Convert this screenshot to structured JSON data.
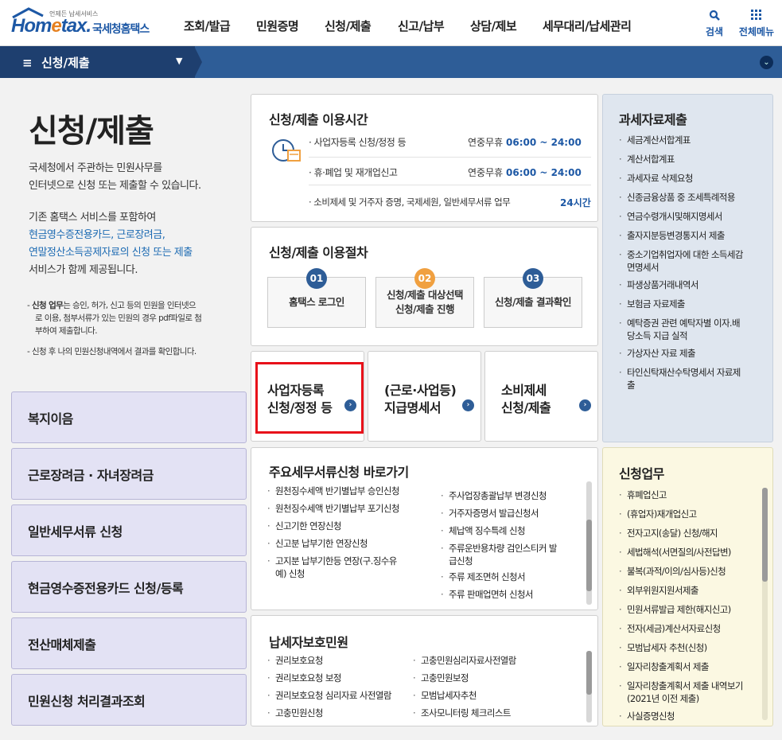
{
  "header": {
    "logo_tagline": "언제든 납세서비스",
    "logo_brand_a": "Hom",
    "logo_brand_e": "e",
    "logo_brand_b": "tax.",
    "logo_korean": "국세청홈택스",
    "menu": [
      "조회/발급",
      "민원증명",
      "신청/제출",
      "신고/납부",
      "상담/제보",
      "세무대리/납세관리"
    ],
    "search_label": "검색",
    "allmenu_label": "전체메뉴"
  },
  "subnav": {
    "title": "신청/제출",
    "hamburger": "≡",
    "caret": "▼",
    "expand": "⌄"
  },
  "intro": {
    "page_title": "신청/제출",
    "desc1_l1": "국세청에서 주관하는 민원사무를",
    "desc1_l2": "인터넷으로 신청 또는 제출할 수 있습니다.",
    "desc2_l1": "기존 홈택스 서비스를 포함하여",
    "desc2_blue1": "현금영수증전용카드, 근로장려금,",
    "desc2_blue2": "연말정산소득공제자료의 신청 또는 제출",
    "desc2_l4": "서비스가 함께 제공됩니다.",
    "note1_bold": "신청 업무",
    "note1_rest": "는 승인, 허가, 신고 등의 민원을 인터넷으",
    "note1_l2": "로 이용, 첨부서류가 있는 민원의 경우 pdf파일로 첨",
    "note1_l3": "부하여 제출합니다.",
    "note2": "신청 후 나의 민원신청내역에서 결과를 확인합니다."
  },
  "left_buttons": [
    "복지이음",
    "근로장려금 · 자녀장려금",
    "일반세무서류 신청",
    "현금영수증전용카드 신청/등록",
    "전산매체제출",
    "민원신청 처리결과조회"
  ],
  "hours": {
    "title": "신청/제출 이용시간",
    "rows": [
      {
        "label": "· 사업자등록 신청/정정 등",
        "prefix": "연중무휴",
        "time": "06:00 ~ 24:00"
      },
      {
        "label": "· 휴·폐업 및 재개업신고",
        "prefix": "연중무휴",
        "time": "06:00 ~ 24:00"
      },
      {
        "label": "· 소비제세 및 거주자 증명, 국제세원, 일반세무서류 업무",
        "prefix": "",
        "time": "24시간"
      }
    ]
  },
  "process": {
    "title": "신청/제출 이용절차",
    "steps": [
      {
        "num": "01",
        "l1": "홈택스 로그인",
        "l2": "",
        "color": "#2e5d97"
      },
      {
        "num": "02",
        "l1": "신청/제출 대상선택",
        "l2": "신청/제출 진행",
        "color": "#f0a040"
      },
      {
        "num": "03",
        "l1": "신청/제출 결과확인",
        "l2": "",
        "color": "#2e5d97"
      }
    ]
  },
  "big_cards": [
    {
      "l1": "사업자등록",
      "l2": "신청/정정 등",
      "highlighted": true
    },
    {
      "l1": "(근로·사업등)",
      "l2": "지급명세서",
      "highlighted": false
    },
    {
      "l1": "소비제세",
      "l2": "신청/제출",
      "highlighted": false
    }
  ],
  "tax_data": {
    "title": "과세자료제출",
    "items": [
      "세금계산서합계표",
      "계산서합계표",
      "과세자료 삭제요청",
      "신종금융상품 중 조세특례적용",
      "연금수령개시및해지명세서",
      "출자지분등변경통지서 제출",
      "중소기업취업자에 대한 소득세감",
      "면명세서",
      "파생상품거래내역서",
      "보험금 자료제출",
      "예탁증권 관련 예탁자별 이자.배",
      "당소득 지급 실적",
      "가상자산 자료 제출",
      "타인신탁재산수탁명세서 자료제",
      "출"
    ]
  },
  "shortcuts": {
    "title": "주요세무서류신청 바로가기",
    "col1": [
      "원천징수세액 반기별납부 승인신청",
      "원천징수세액 반기별납부 포기신청",
      "신고기한 연장신청",
      "신고분 납부기한 연장신청",
      "고지분 납부기한등 연장(구.징수유",
      "예) 신청"
    ],
    "col2": [
      "주사업장총괄납부 변경신청",
      "거주자증명서 발급신청서",
      "체납액 징수특례 신청",
      "주류운반용차량 검인스티커 발",
      "급신청",
      "주류 제조면허 신청서",
      "주류 판매업면허 신청서"
    ]
  },
  "protection": {
    "title": "납세자보호민원",
    "col1": [
      "권리보호요청",
      "권리보호요청 보정",
      "권리보호요청 심리자료 사전열람",
      "고충민원신청"
    ],
    "col2": [
      "고충민원심리자료사전열람",
      "고충민원보정",
      "모범납세자추천",
      "조사모니터링 체크리스트"
    ]
  },
  "apply_work": {
    "title": "신청업무",
    "items": [
      "휴폐업신고",
      "(휴업자)재개업신고",
      "전자고지(송달) 신청/해지",
      "세법해석(서면질의/사전답변)",
      "불복(과적/이의/심사등)신청",
      "외부위원지원서제출",
      "민원서류발급 제한(해지신고)",
      "전자(세금)계산서자료신청",
      "모범납세자 추천(신청)",
      "일자리창출계획서 제출",
      "일자리창출계획서 제출 내역보기",
      "(2021년 이전 제출)",
      "사실증명신청"
    ]
  },
  "colors": {
    "brand": "#1d58a5",
    "nav_bar": "#2e5d97",
    "highlight": "#e8111a",
    "orange": "#e6801f"
  }
}
